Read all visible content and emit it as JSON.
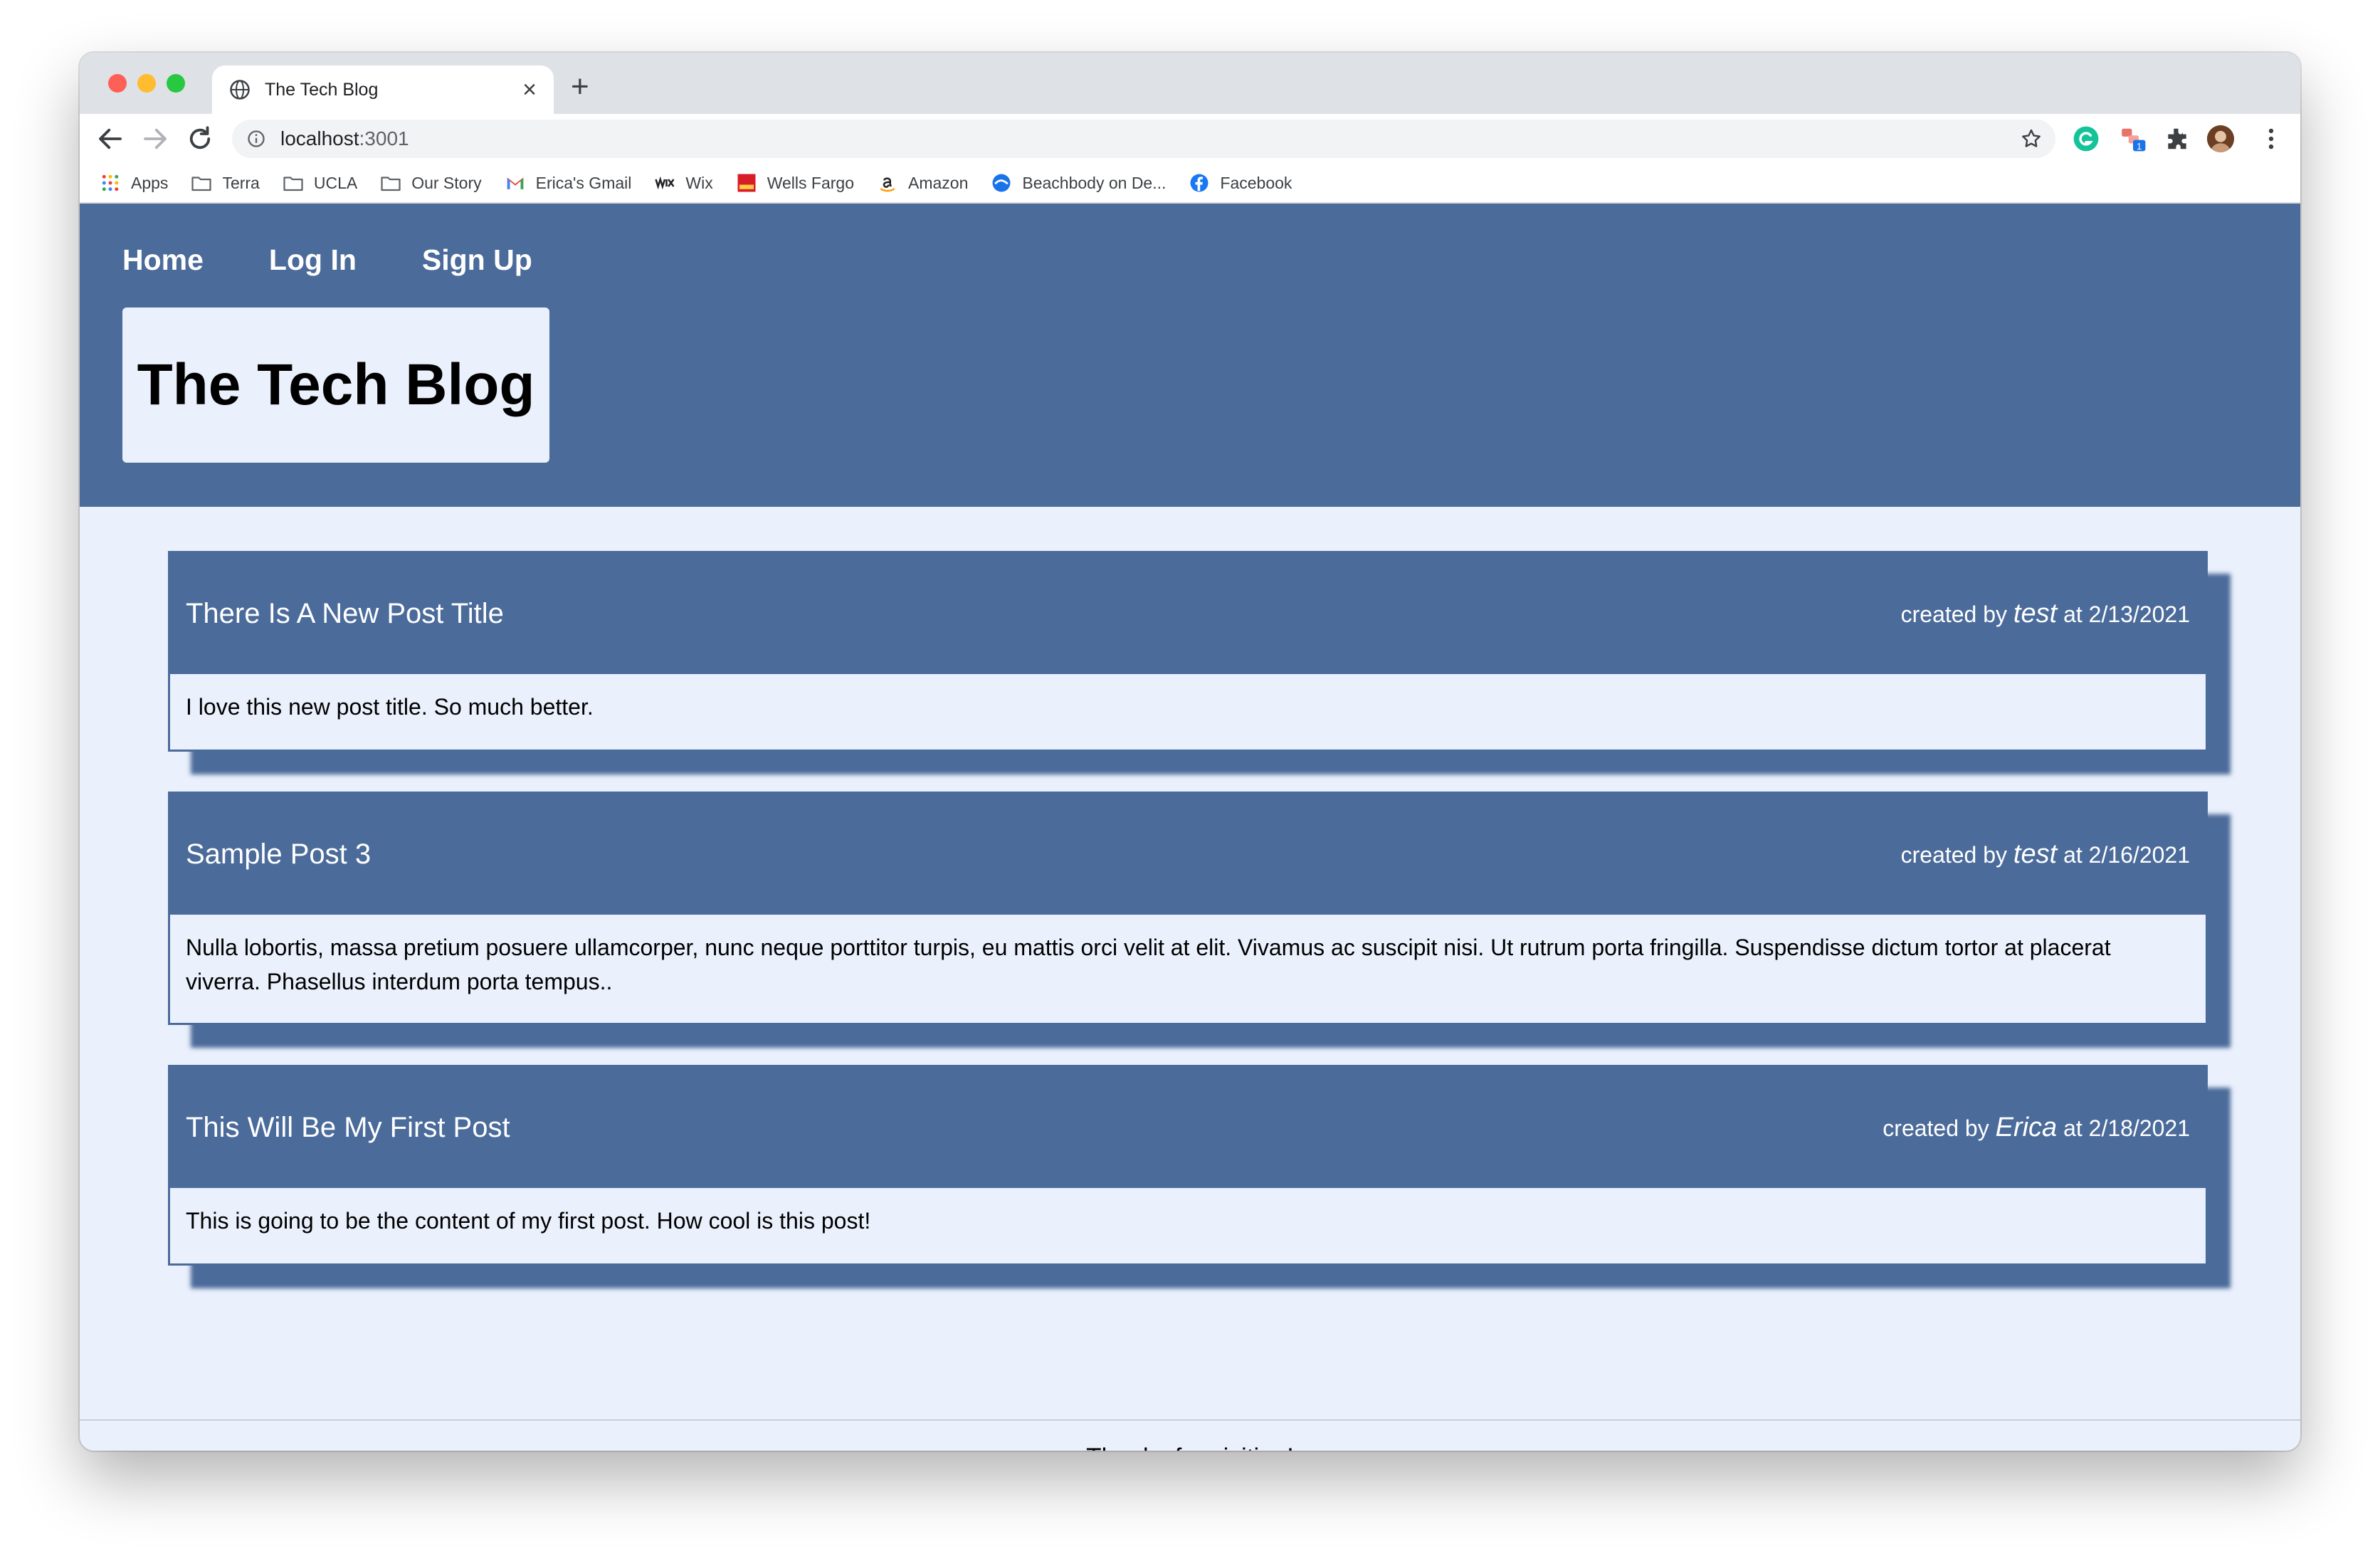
{
  "browser": {
    "tab_title": "The Tech Blog",
    "url_host": "localhost",
    "url_port": ":3001",
    "bookmarks": [
      {
        "label": "Apps",
        "icon": "apps-grid-icon"
      },
      {
        "label": "Terra",
        "icon": "folder-icon"
      },
      {
        "label": "UCLA",
        "icon": "folder-icon"
      },
      {
        "label": "Our Story",
        "icon": "folder-icon"
      },
      {
        "label": "Erica's Gmail",
        "icon": "gmail-icon"
      },
      {
        "label": "Wix",
        "icon": "wix-icon"
      },
      {
        "label": "Wells Fargo",
        "icon": "wells-fargo-icon"
      },
      {
        "label": "Amazon",
        "icon": "amazon-icon"
      },
      {
        "label": "Beachbody on De...",
        "icon": "beachbody-icon"
      },
      {
        "label": "Facebook",
        "icon": "facebook-icon"
      }
    ],
    "extension_badge": "1"
  },
  "site": {
    "nav": {
      "home": "Home",
      "login": "Log In",
      "signup": "Sign Up"
    },
    "brand": "The Tech Blog",
    "footer": "Thanks for visiting!",
    "colors": {
      "header": "#4b6b9a",
      "background": "#eaf0fc"
    }
  },
  "posts": [
    {
      "title": "There Is A New Post Title",
      "created_by_label": "created by",
      "author": "test",
      "at_label": "at",
      "date": "2/13/2021",
      "body": "I love this new post title. So much better."
    },
    {
      "title": "Sample Post 3",
      "created_by_label": "created by",
      "author": "test",
      "at_label": "at",
      "date": "2/16/2021",
      "body": "Nulla lobortis, massa pretium posuere ullamcorper, nunc neque porttitor turpis, eu mattis orci velit at elit. Vivamus ac suscipit nisi. Ut rutrum porta fringilla. Suspendisse dictum tortor at placerat viverra. Phasellus interdum porta tempus.."
    },
    {
      "title": "This Will Be My First Post",
      "created_by_label": "created by",
      "author": "Erica",
      "at_label": "at",
      "date": "2/18/2021",
      "body": "This is going to be the content of my first post. How cool is this post!"
    }
  ]
}
